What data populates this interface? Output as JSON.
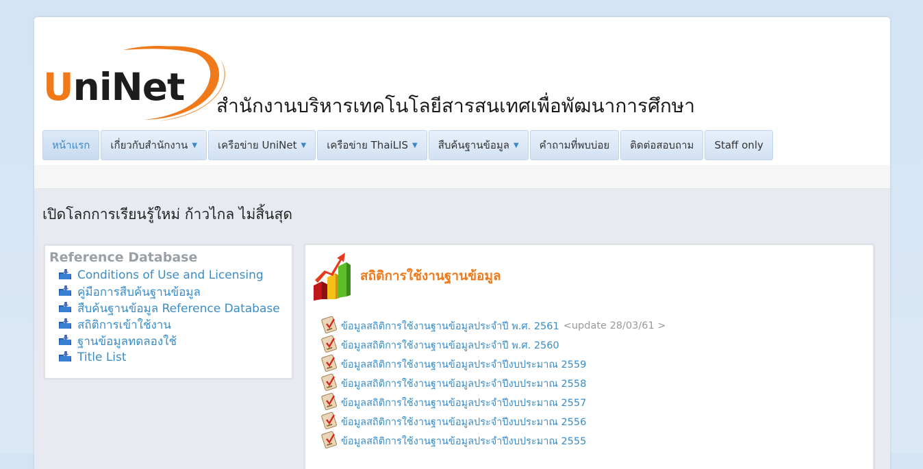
{
  "header": {
    "logo_text_u": "U",
    "logo_text_rest": "niNet",
    "org_name": "สำนักงานบริหารเทคโนโลยีสารสนเทศเพื่อพัฒนาการศึกษา"
  },
  "nav": {
    "items": [
      {
        "label": "หน้าแรก",
        "active": true,
        "dropdown": false
      },
      {
        "label": "เกี่ยวกับสำนักงาน",
        "active": false,
        "dropdown": true
      },
      {
        "label": "เครือข่าย UniNet",
        "active": false,
        "dropdown": true
      },
      {
        "label": "เครือข่าย ThaiLIS",
        "active": false,
        "dropdown": true
      },
      {
        "label": "สืบค้นฐานข้อมูล",
        "active": false,
        "dropdown": true
      },
      {
        "label": "คำถามที่พบบ่อย",
        "active": false,
        "dropdown": false
      },
      {
        "label": "ติดต่อสอบถาม",
        "active": false,
        "dropdown": false
      },
      {
        "label": "Staff only",
        "active": false,
        "dropdown": false
      }
    ]
  },
  "tagline": "เปิดโลกการเรียนรู้ใหม่ ก้าวไกล ไม่สิ้นสุด",
  "reference": {
    "title": "Reference Database",
    "links": [
      "Conditions of Use and Licensing",
      "คู่มือการสืบค้นฐานข้อมูล",
      "สืบค้นฐานข้อมูล Reference Database",
      "สถิติการเข้าใช้งาน",
      "ฐานข้อมูลทดลองใช้",
      "Title List"
    ]
  },
  "stats": {
    "title": "สถิติการใช้งานฐานข้อมูล",
    "links": [
      {
        "label": "ข้อมูลสถิติการใช้งานฐานข้อมูลประจำปี พ.ศ. 2561",
        "note": "<update 28/03/61 >"
      },
      {
        "label": "ข้อมูลสถิติการใช้งานฐานข้อมูลประจำปี พ.ศ. 2560",
        "note": ""
      },
      {
        "label": "ข้อมูลสถิติการใช้งานฐานข้อมูลประจำปีงบประมาณ 2559",
        "note": ""
      },
      {
        "label": "ข้อมูลสถิติการใช้งานฐานข้อมูลประจำปีงบประมาณ 2558",
        "note": ""
      },
      {
        "label": "ข้อมูลสถิติการใช้งานฐานข้อมูลประจำปีงบประมาณ 2557",
        "note": ""
      },
      {
        "label": "ข้อมูลสถิติการใช้งานฐานข้อมูลประจำปีงบประมาณ 2556",
        "note": ""
      },
      {
        "label": "ข้อมูลสถิติการใช้งานฐานข้อมูลประจำปีงบประมาณ 2555",
        "note": ""
      }
    ]
  },
  "colors": {
    "accent_orange": "#f07a1a",
    "link_blue": "#3b8cc4",
    "background": "#d3e4f5"
  }
}
